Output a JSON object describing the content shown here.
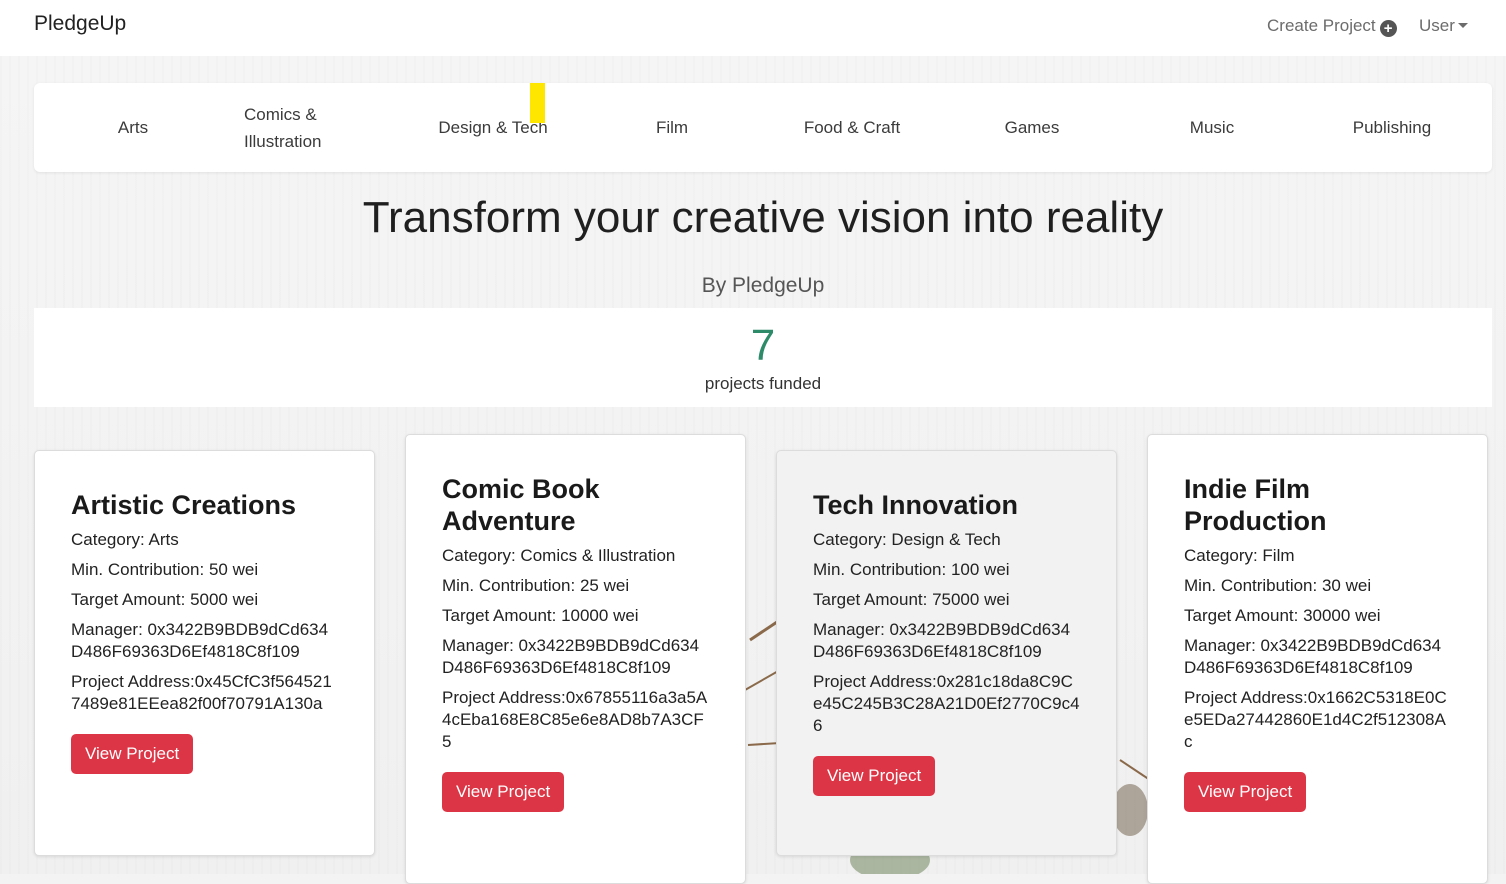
{
  "navbar": {
    "brand": "PledgeUp",
    "create_project": "Create Project",
    "user": "User"
  },
  "categories": [
    "Arts",
    "Comics & Illustration",
    "Design & Tech",
    "Film",
    "Food & Craft",
    "Games",
    "Music",
    "Publishing"
  ],
  "hero": {
    "title": "Transform your creative vision into reality",
    "subtitle": "By PledgeUp"
  },
  "stats": {
    "count": "7",
    "label": "projects funded"
  },
  "cards": [
    {
      "title": "Artistic Creations",
      "category": "Category: Arts",
      "min_contribution": "Min. Contribution: 50 wei",
      "target": "Target Amount: 5000 wei",
      "manager": "Manager: 0x3422B9BDB9dCd634D486F69363D6Ef4818C8f109",
      "address": "Project Address:0x45CfC3f5645217489e81EEea82f00f70791A130a",
      "button": "View Project"
    },
    {
      "title": "Comic Book Adventure",
      "category": "Category: Comics & Illustration",
      "min_contribution": "Min. Contribution: 25 wei",
      "target": "Target Amount: 10000 wei",
      "manager": "Manager: 0x3422B9BDB9dCd634D486F69363D6Ef4818C8f109",
      "address": "Project Address:0x67855116a3a5A4cEba168E8C85e6e8AD8b7A3CF5",
      "button": "View Project"
    },
    {
      "title": "Tech Innovation",
      "category": "Category: Design & Tech",
      "min_contribution": "Min. Contribution: 100 wei",
      "target": "Target Amount: 75000 wei",
      "manager": "Manager: 0x3422B9BDB9dCd634D486F69363D6Ef4818C8f109",
      "address": "Project Address:0x281c18da8C9Ce45C245B3C28A21D0Ef2770C9c46",
      "button": "View Project"
    },
    {
      "title": "Indie Film Production",
      "category": "Category: Film",
      "min_contribution": "Min. Contribution: 30 wei",
      "target": "Target Amount: 30000 wei",
      "manager": "Manager: 0x3422B9BDB9dCd634D486F69363D6Ef4818C8f109",
      "address": "Project Address:0x1662C5318E0Ce5EDa27442860E1d4C2f512308Ac",
      "button": "View Project"
    }
  ]
}
